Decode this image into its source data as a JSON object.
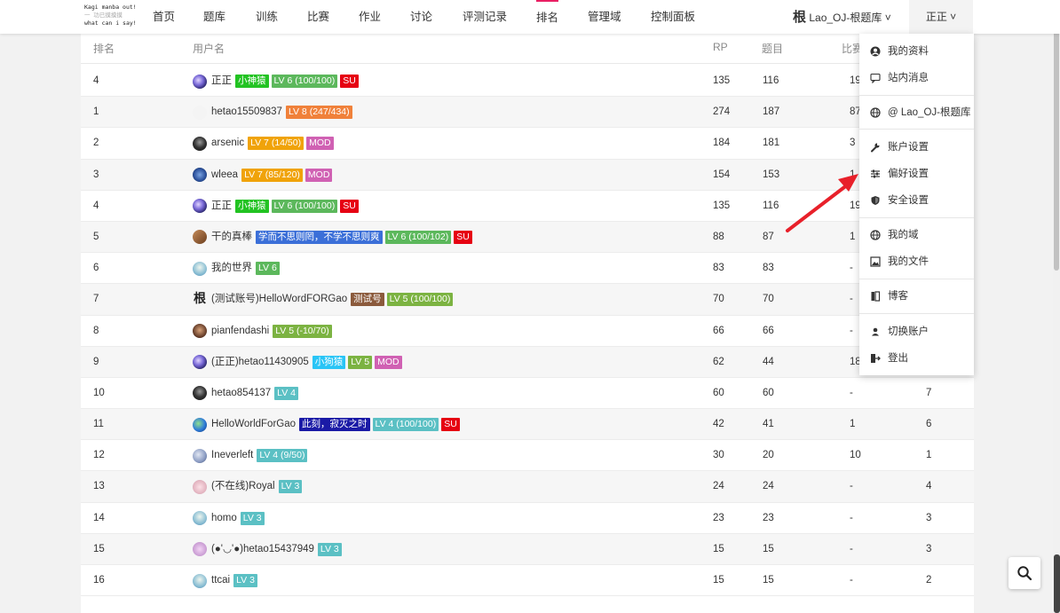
{
  "logo": {
    "line1": "Kagi manba out!",
    "line2": "一 功已摸摸摸",
    "line3": "what can i say!"
  },
  "nav": {
    "items": [
      "首页",
      "题库",
      "训练",
      "比赛",
      "作业",
      "讨论",
      "评测记录",
      "排名",
      "管理域",
      "控制面板"
    ],
    "active": "排名",
    "domain_char": "根",
    "domain": "Lao_OJ-根题库 ˅",
    "user": "正正 ˅"
  },
  "table": {
    "headers": {
      "rank": "排名",
      "user": "用户名",
      "rp": "RP",
      "problems": "题目",
      "contests": "比赛"
    },
    "rows": [
      {
        "rank": "4",
        "avatar": "galaxy",
        "name": "正正",
        "badges": [
          {
            "t": "小神猿",
            "c": "#22c322"
          },
          {
            "t": "LV 6 (100/100)",
            "c": "#5cb85c"
          },
          {
            "t": "SU",
            "c": "#e60012"
          }
        ],
        "rp": "135",
        "problems": "116",
        "contests": "19",
        "hw": ""
      },
      {
        "rank": "1",
        "avatar": "blank",
        "name": "hetao15509837",
        "badges": [
          {
            "t": "LV 8 (247/434)",
            "c": "#f0813a"
          }
        ],
        "rp": "274",
        "problems": "187",
        "contests": "87",
        "hw": ""
      },
      {
        "rank": "2",
        "avatar": "dark",
        "name": "arsenic",
        "badges": [
          {
            "t": "LV 7 (14/50)",
            "c": "#f0a30a"
          },
          {
            "t": "MOD",
            "c": "#d061b3"
          }
        ],
        "rp": "184",
        "problems": "181",
        "contests": "3",
        "hw": ""
      },
      {
        "rank": "3",
        "avatar": "owl",
        "name": "wleea",
        "badges": [
          {
            "t": "LV 7 (85/120)",
            "c": "#f0a30a"
          },
          {
            "t": "MOD",
            "c": "#d061b3"
          }
        ],
        "rp": "154",
        "problems": "153",
        "contests": "1",
        "hw": ""
      },
      {
        "rank": "4",
        "avatar": "galaxy",
        "name": "正正",
        "badges": [
          {
            "t": "小神猿",
            "c": "#22c322"
          },
          {
            "t": "LV 6 (100/100)",
            "c": "#5cb85c"
          },
          {
            "t": "SU",
            "c": "#e60012"
          }
        ],
        "rp": "135",
        "problems": "116",
        "contests": "19",
        "hw": ""
      },
      {
        "rank": "5",
        "avatar": "dog",
        "name": "干的真棒",
        "badges": [
          {
            "t": "学而不思则罔，不学不思则爽",
            "c": "#3b6fd8"
          },
          {
            "t": "LV 6 (100/102)",
            "c": "#5cb85c"
          },
          {
            "t": "SU",
            "c": "#e60012"
          }
        ],
        "rp": "88",
        "problems": "87",
        "contests": "1",
        "hw": ""
      },
      {
        "rank": "6",
        "avatar": "default",
        "name": "我的世界",
        "badges": [
          {
            "t": "LV 6",
            "c": "#5cb85c"
          }
        ],
        "rp": "83",
        "problems": "83",
        "contests": "-",
        "hw": ""
      },
      {
        "rank": "7",
        "avatar": "char",
        "char": "根",
        "name": "(测试账号)HelloWordFORGao",
        "badges": [
          {
            "t": "测试号",
            "c": "#8b5a3c"
          },
          {
            "t": "LV 5 (100/100)",
            "c": "#7cb342"
          }
        ],
        "rp": "70",
        "problems": "70",
        "contests": "-",
        "hw": ""
      },
      {
        "rank": "8",
        "avatar": "face",
        "name": "pianfendashi",
        "badges": [
          {
            "t": "LV 5 (-10/70)",
            "c": "#7cb342"
          }
        ],
        "rp": "66",
        "problems": "66",
        "contests": "-",
        "hw": ""
      },
      {
        "rank": "9",
        "avatar": "galaxy",
        "name": "(正正)hetao11430905",
        "badges": [
          {
            "t": "小狗猿",
            "c": "#29c5f6"
          },
          {
            "t": "LV 5",
            "c": "#7cb342"
          },
          {
            "t": "MOD",
            "c": "#d061b3"
          }
        ],
        "rp": "62",
        "problems": "44",
        "contests": "18",
        "hw": ""
      },
      {
        "rank": "10",
        "avatar": "dark",
        "name": "hetao854137",
        "badges": [
          {
            "t": "LV 4",
            "c": "#5bc0c4"
          }
        ],
        "rp": "60",
        "problems": "60",
        "contests": "-",
        "hw": "7"
      },
      {
        "rank": "11",
        "avatar": "earth",
        "name": "HelloWorldForGao",
        "badges": [
          {
            "t": "此刻，寂灭之时",
            "c": "#1a1aa6"
          },
          {
            "t": "LV 4 (100/100)",
            "c": "#5bc0c4"
          },
          {
            "t": "SU",
            "c": "#e60012"
          }
        ],
        "rp": "42",
        "problems": "41",
        "contests": "1",
        "hw": "6"
      },
      {
        "rank": "12",
        "avatar": "sphere",
        "name": "Ineverleft",
        "badges": [
          {
            "t": "LV 4 (9/50)",
            "c": "#5bc0c4"
          }
        ],
        "rp": "30",
        "problems": "20",
        "contests": "10",
        "hw": "1"
      },
      {
        "rank": "13",
        "avatar": "flower",
        "name": "(不在线)Royal",
        "badges": [
          {
            "t": "LV 3",
            "c": "#5bc0c4"
          }
        ],
        "rp": "24",
        "problems": "24",
        "contests": "-",
        "hw": "4"
      },
      {
        "rank": "14",
        "avatar": "default",
        "name": "homo",
        "badges": [
          {
            "t": "LV 3",
            "c": "#5bc0c4"
          }
        ],
        "rp": "23",
        "problems": "23",
        "contests": "-",
        "hw": "3"
      },
      {
        "rank": "15",
        "avatar": "pink",
        "name": "(●'◡'●)hetao15437949",
        "badges": [
          {
            "t": "LV 3",
            "c": "#5bc0c4"
          }
        ],
        "rp": "15",
        "problems": "15",
        "contests": "-",
        "hw": "3"
      },
      {
        "rank": "16",
        "avatar": "default",
        "name": "ttcai",
        "badges": [
          {
            "t": "LV 3",
            "c": "#5bc0c4"
          }
        ],
        "rp": "15",
        "problems": "15",
        "contests": "-",
        "hw": "2"
      }
    ]
  },
  "dropdown": {
    "items": [
      {
        "label": "我的资料",
        "icon": "user-circle-icon"
      },
      {
        "label": "站内消息",
        "icon": "message-icon"
      },
      {
        "label": "@ Lao_OJ-根题库",
        "icon": "globe-icon"
      },
      {
        "label": "账户设置",
        "icon": "wrench-icon"
      },
      {
        "label": "偏好设置",
        "icon": "sliders-icon"
      },
      {
        "label": "安全设置",
        "icon": "shield-icon"
      },
      {
        "label": "我的域",
        "icon": "globe-icon"
      },
      {
        "label": "我的文件",
        "icon": "image-icon"
      },
      {
        "label": "博客",
        "icon": "book-icon"
      },
      {
        "label": "切换账户",
        "icon": "user-icon"
      },
      {
        "label": "登出",
        "icon": "logout-icon"
      }
    ]
  },
  "colors": {
    "accent": "#e91e63",
    "annotation_arrow": "#e8202a"
  }
}
